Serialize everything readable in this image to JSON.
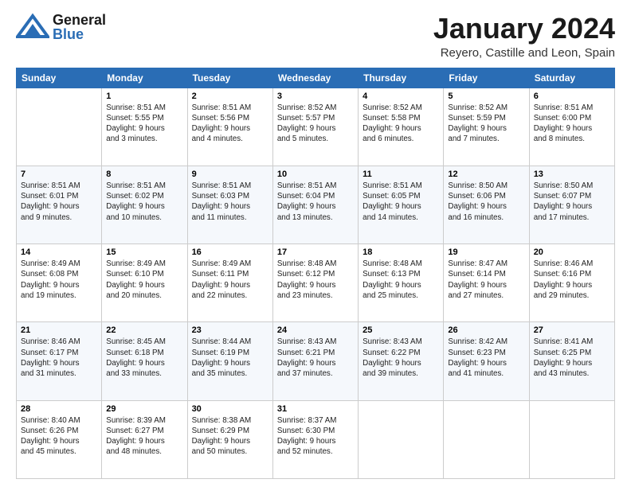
{
  "header": {
    "logo_general": "General",
    "logo_blue": "Blue",
    "month": "January 2024",
    "location": "Reyero, Castille and Leon, Spain"
  },
  "weekdays": [
    "Sunday",
    "Monday",
    "Tuesday",
    "Wednesday",
    "Thursday",
    "Friday",
    "Saturday"
  ],
  "weeks": [
    [
      {
        "day": "",
        "info": ""
      },
      {
        "day": "1",
        "info": "Sunrise: 8:51 AM\nSunset: 5:55 PM\nDaylight: 9 hours\nand 3 minutes."
      },
      {
        "day": "2",
        "info": "Sunrise: 8:51 AM\nSunset: 5:56 PM\nDaylight: 9 hours\nand 4 minutes."
      },
      {
        "day": "3",
        "info": "Sunrise: 8:52 AM\nSunset: 5:57 PM\nDaylight: 9 hours\nand 5 minutes."
      },
      {
        "day": "4",
        "info": "Sunrise: 8:52 AM\nSunset: 5:58 PM\nDaylight: 9 hours\nand 6 minutes."
      },
      {
        "day": "5",
        "info": "Sunrise: 8:52 AM\nSunset: 5:59 PM\nDaylight: 9 hours\nand 7 minutes."
      },
      {
        "day": "6",
        "info": "Sunrise: 8:51 AM\nSunset: 6:00 PM\nDaylight: 9 hours\nand 8 minutes."
      }
    ],
    [
      {
        "day": "7",
        "info": "Sunrise: 8:51 AM\nSunset: 6:01 PM\nDaylight: 9 hours\nand 9 minutes."
      },
      {
        "day": "8",
        "info": "Sunrise: 8:51 AM\nSunset: 6:02 PM\nDaylight: 9 hours\nand 10 minutes."
      },
      {
        "day": "9",
        "info": "Sunrise: 8:51 AM\nSunset: 6:03 PM\nDaylight: 9 hours\nand 11 minutes."
      },
      {
        "day": "10",
        "info": "Sunrise: 8:51 AM\nSunset: 6:04 PM\nDaylight: 9 hours\nand 13 minutes."
      },
      {
        "day": "11",
        "info": "Sunrise: 8:51 AM\nSunset: 6:05 PM\nDaylight: 9 hours\nand 14 minutes."
      },
      {
        "day": "12",
        "info": "Sunrise: 8:50 AM\nSunset: 6:06 PM\nDaylight: 9 hours\nand 16 minutes."
      },
      {
        "day": "13",
        "info": "Sunrise: 8:50 AM\nSunset: 6:07 PM\nDaylight: 9 hours\nand 17 minutes."
      }
    ],
    [
      {
        "day": "14",
        "info": "Sunrise: 8:49 AM\nSunset: 6:08 PM\nDaylight: 9 hours\nand 19 minutes."
      },
      {
        "day": "15",
        "info": "Sunrise: 8:49 AM\nSunset: 6:10 PM\nDaylight: 9 hours\nand 20 minutes."
      },
      {
        "day": "16",
        "info": "Sunrise: 8:49 AM\nSunset: 6:11 PM\nDaylight: 9 hours\nand 22 minutes."
      },
      {
        "day": "17",
        "info": "Sunrise: 8:48 AM\nSunset: 6:12 PM\nDaylight: 9 hours\nand 23 minutes."
      },
      {
        "day": "18",
        "info": "Sunrise: 8:48 AM\nSunset: 6:13 PM\nDaylight: 9 hours\nand 25 minutes."
      },
      {
        "day": "19",
        "info": "Sunrise: 8:47 AM\nSunset: 6:14 PM\nDaylight: 9 hours\nand 27 minutes."
      },
      {
        "day": "20",
        "info": "Sunrise: 8:46 AM\nSunset: 6:16 PM\nDaylight: 9 hours\nand 29 minutes."
      }
    ],
    [
      {
        "day": "21",
        "info": "Sunrise: 8:46 AM\nSunset: 6:17 PM\nDaylight: 9 hours\nand 31 minutes."
      },
      {
        "day": "22",
        "info": "Sunrise: 8:45 AM\nSunset: 6:18 PM\nDaylight: 9 hours\nand 33 minutes."
      },
      {
        "day": "23",
        "info": "Sunrise: 8:44 AM\nSunset: 6:19 PM\nDaylight: 9 hours\nand 35 minutes."
      },
      {
        "day": "24",
        "info": "Sunrise: 8:43 AM\nSunset: 6:21 PM\nDaylight: 9 hours\nand 37 minutes."
      },
      {
        "day": "25",
        "info": "Sunrise: 8:43 AM\nSunset: 6:22 PM\nDaylight: 9 hours\nand 39 minutes."
      },
      {
        "day": "26",
        "info": "Sunrise: 8:42 AM\nSunset: 6:23 PM\nDaylight: 9 hours\nand 41 minutes."
      },
      {
        "day": "27",
        "info": "Sunrise: 8:41 AM\nSunset: 6:25 PM\nDaylight: 9 hours\nand 43 minutes."
      }
    ],
    [
      {
        "day": "28",
        "info": "Sunrise: 8:40 AM\nSunset: 6:26 PM\nDaylight: 9 hours\nand 45 minutes."
      },
      {
        "day": "29",
        "info": "Sunrise: 8:39 AM\nSunset: 6:27 PM\nDaylight: 9 hours\nand 48 minutes."
      },
      {
        "day": "30",
        "info": "Sunrise: 8:38 AM\nSunset: 6:29 PM\nDaylight: 9 hours\nand 50 minutes."
      },
      {
        "day": "31",
        "info": "Sunrise: 8:37 AM\nSunset: 6:30 PM\nDaylight: 9 hours\nand 52 minutes."
      },
      {
        "day": "",
        "info": ""
      },
      {
        "day": "",
        "info": ""
      },
      {
        "day": "",
        "info": ""
      }
    ]
  ]
}
